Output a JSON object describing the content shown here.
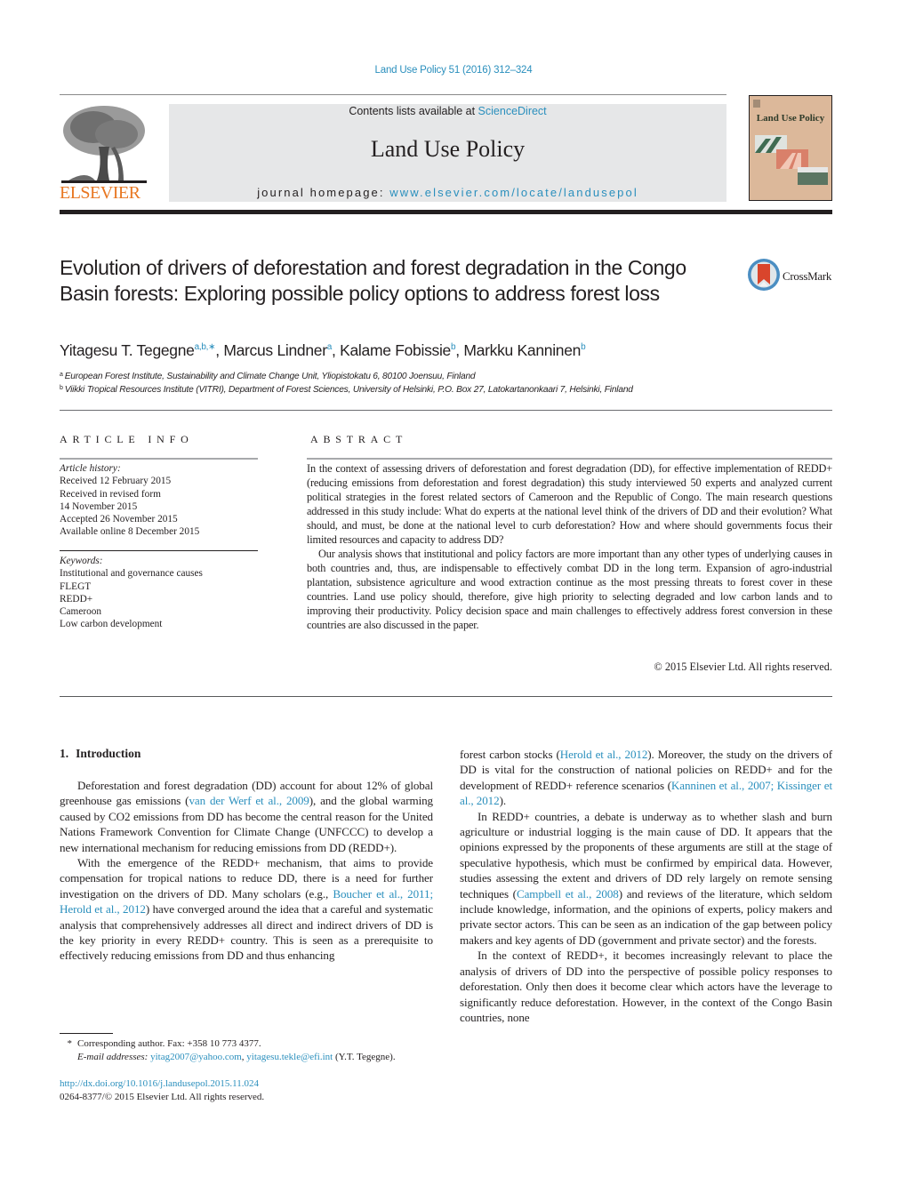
{
  "header": {
    "citation": "Land Use Policy 51 (2016) 312–324",
    "contents_prefix": "Contents lists available at ",
    "contents_link": "ScienceDirect",
    "journal_name": "Land Use Policy",
    "homepage_prefix": "journal homepage: ",
    "homepage_link": "www.elsevier.com/locate/landusepol",
    "publisher_logo_text": "ELSEVIER",
    "cover_title": "Land Use Policy",
    "crossmark_label": "CrossMark",
    "colors": {
      "link": "#2a8fbd",
      "elsevier_orange": "#e87722",
      "banner_bg": "#e6e7e8",
      "cover_bg": "#dcb89a"
    }
  },
  "article": {
    "title": "Evolution of drivers of deforestation and forest degradation in the Congo Basin forests: Exploring possible policy options to address forest loss",
    "authors": [
      {
        "name": "Yitagesu T. Tegegne",
        "sup": "a,b,",
        "corresponding": "∗"
      },
      {
        "name": "Marcus Lindner",
        "sup": "a"
      },
      {
        "name": "Kalame Fobissie",
        "sup": "b"
      },
      {
        "name": "Markku Kanninen",
        "sup": "b"
      }
    ],
    "affiliations": [
      {
        "label": "a",
        "text": "European Forest Institute, Sustainability and Climate Change Unit, Yliopistokatu 6, 80100 Joensuu, Finland"
      },
      {
        "label": "b",
        "text": "Viikki Tropical Resources Institute (VITRI), Department of Forest Sciences, University of Helsinki, P.O. Box 27, Latokartanonkaari 7, Helsinki, Finland"
      }
    ]
  },
  "article_info": {
    "heading": "ARTICLE INFO",
    "history_label": "Article history:",
    "history": [
      "Received 12 February 2015",
      "Received in revised form",
      "14 November 2015",
      "Accepted 26 November 2015",
      "Available online 8 December 2015"
    ],
    "keywords_label": "Keywords:",
    "keywords": [
      "Institutional and governance causes",
      "FLEGT",
      "REDD+",
      "Cameroon",
      "Low carbon development"
    ]
  },
  "abstract": {
    "heading": "ABSTRACT",
    "paragraphs": [
      "In the context of assessing drivers of deforestation and forest degradation (DD), for effective implementation of REDD+ (reducing emissions from deforestation and forest degradation) this study interviewed 50 experts and analyzed current political strategies in the forest related sectors of Cameroon and the Republic of Congo. The main research questions addressed in this study include: What do experts at the national level think of the drivers of DD and their evolution? What should, and must, be done at the national level to curb deforestation? How and where should governments focus their limited resources and capacity to address DD?",
      "Our analysis shows that institutional and policy factors are more important than any other types of underlying causes in both countries and, thus, are indispensable to effectively combat DD in the long term. Expansion of agro-industrial plantation, subsistence agriculture and wood extraction continue as the most pressing threats to forest cover in these countries. Land use policy should, therefore, give high priority to selecting degraded and low carbon lands and to improving their productivity. Policy decision space and main challenges to effectively address forest conversion in these countries are also discussed in the paper."
    ],
    "copyright": "© 2015 Elsevier Ltd. All rights reserved."
  },
  "introduction": {
    "number": "1.",
    "heading": "Introduction",
    "left_column": [
      {
        "indent": true,
        "parts": [
          {
            "text": "Deforestation and forest degradation (DD) account for about 12% of global greenhouse gas emissions ("
          },
          {
            "text": "van der Werf et al., 2009",
            "link": true
          },
          {
            "text": "), and the global warming caused by CO2 emissions from DD has become the central reason for the United Nations Framework Convention for Climate Change (UNFCCC) to develop a new international mechanism for reducing emissions from DD (REDD+)."
          }
        ]
      },
      {
        "indent": true,
        "parts": [
          {
            "text": "With the emergence of the REDD+ mechanism, that aims to provide compensation for tropical nations to reduce DD, there is a need for further investigation on the drivers of DD. Many scholars (e.g., "
          },
          {
            "text": "Boucher et al., 2011; Herold et al., 2012",
            "link": true
          },
          {
            "text": ") have converged around the idea that a careful and systematic analysis that comprehensively addresses all direct and indirect drivers of DD is the key priority in every REDD+ country. This is seen as a prerequisite to effectively reducing emissions from DD and thus enhancing"
          }
        ]
      }
    ],
    "right_column": [
      {
        "indent": false,
        "parts": [
          {
            "text": "forest carbon stocks ("
          },
          {
            "text": "Herold et al., 2012",
            "link": true
          },
          {
            "text": "). Moreover, the study on the drivers of DD is vital for the construction of national policies on REDD+ and for the development of REDD+ reference scenarios ("
          },
          {
            "text": "Kanninen et al., 2007; Kissinger et al., 2012",
            "link": true
          },
          {
            "text": ")."
          }
        ]
      },
      {
        "indent": true,
        "parts": [
          {
            "text": "In REDD+ countries, a debate is underway as to whether slash and burn agriculture or industrial logging is the main cause of DD. It appears that the opinions expressed by the proponents of these arguments are still at the stage of speculative hypothesis, which must be confirmed by empirical data. However, studies assessing the extent and drivers of DD rely largely on remote sensing techniques ("
          },
          {
            "text": "Campbell et al., 2008",
            "link": true
          },
          {
            "text": ") and reviews of the literature, which seldom include knowledge, information, and the opinions of experts, policy makers and private sector actors. This can be seen as an indication of the gap between policy makers and key agents of DD (government and private sector) and the forests."
          }
        ]
      },
      {
        "indent": true,
        "parts": [
          {
            "text": "In the context of REDD+, it becomes increasingly relevant to place the analysis of drivers of DD into the perspective of possible policy responses to deforestation. Only then does it become clear which actors have the leverage to significantly reduce deforestation. However, in the context of the Congo Basin countries, none"
          }
        ]
      }
    ]
  },
  "footnotes": {
    "star": "*",
    "corresponding": "Corresponding author. Fax: +358 10 773 4377.",
    "email_label": "E-mail addresses:",
    "email_1": "yitag2007@yahoo.com",
    "email_sep": ", ",
    "email_2": "yitagesu.tekle@efi.int",
    "email_suffix": " (Y.T. Tegegne).",
    "doi": "http://dx.doi.org/10.1016/j.landusepol.2015.11.024",
    "issn_line": "0264-8377/© 2015 Elsevier Ltd. All rights reserved."
  }
}
